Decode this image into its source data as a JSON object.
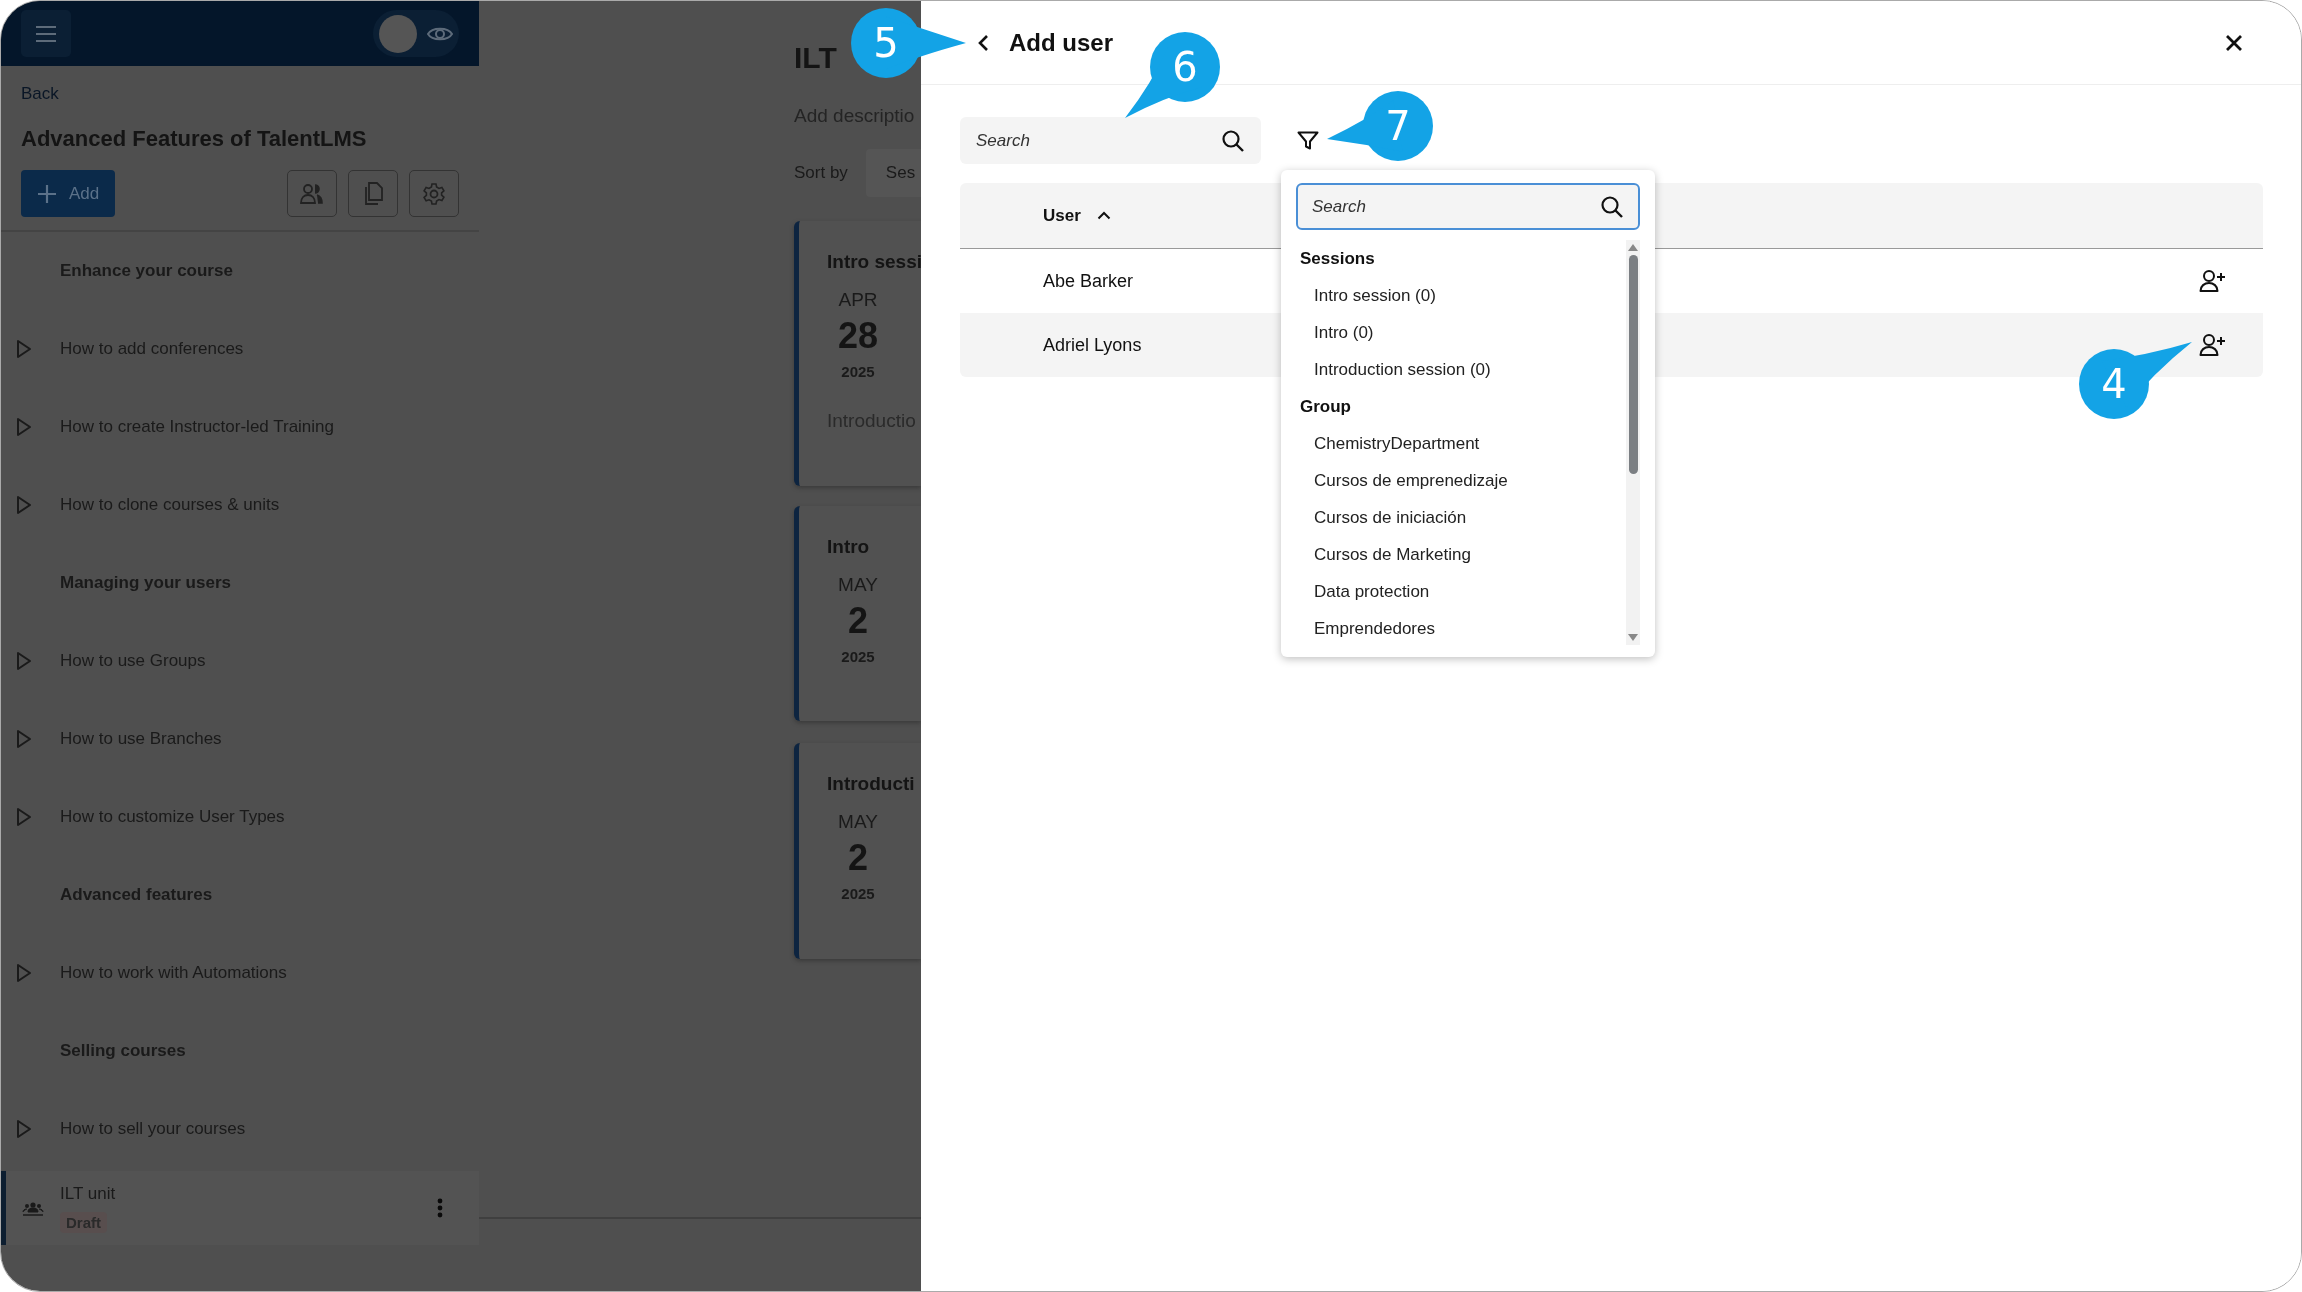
{
  "preview_toggle": {
    "on": false
  },
  "sidebar": {
    "back": "Back",
    "course_title": "Advanced Features of TalentLMS",
    "add_button": "Add",
    "items": [
      {
        "kind": "section",
        "label": "Enhance your course"
      },
      {
        "kind": "unit",
        "label": "How to add conferences"
      },
      {
        "kind": "unit",
        "label": "How to create Instructor-led Training"
      },
      {
        "kind": "unit",
        "label": "How to clone courses & units"
      },
      {
        "kind": "section",
        "label": "Managing your users"
      },
      {
        "kind": "unit",
        "label": "How to use Groups"
      },
      {
        "kind": "unit",
        "label": "How to use Branches"
      },
      {
        "kind": "unit",
        "label": "How to customize User Types"
      },
      {
        "kind": "section",
        "label": "Advanced features"
      },
      {
        "kind": "unit",
        "label": "How to work with Automations"
      },
      {
        "kind": "section",
        "label": "Selling courses"
      },
      {
        "kind": "unit",
        "label": "How to sell your courses"
      }
    ],
    "current_unit": {
      "label": "ILT unit",
      "status": "Draft",
      "selected": true
    }
  },
  "main": {
    "title": "ILT",
    "description_placeholder": "Add descriptio",
    "sort_label": "Sort by",
    "sort_value": "Ses",
    "sessions": [
      {
        "title": "Intro sessi",
        "month": "APR",
        "day": "28",
        "year": "2025",
        "subtitle": "Introductio"
      },
      {
        "title": "Intro",
        "month": "MAY",
        "day": "2",
        "year": "2025"
      },
      {
        "title": "Introducti",
        "month": "MAY",
        "day": "2",
        "year": "2025"
      }
    ]
  },
  "dialog": {
    "title": "Add user",
    "search_placeholder": "Search",
    "column": "User",
    "rows": [
      {
        "name": "Abe Barker"
      },
      {
        "name": "Adriel Lyons"
      }
    ]
  },
  "filter_dropdown": {
    "search_placeholder": "Search",
    "groups": [
      {
        "title": "Sessions",
        "options": [
          "Intro session (0)",
          "Intro (0)",
          "Introduction session (0)"
        ]
      },
      {
        "title": "Group",
        "options": [
          "ChemistryDepartment",
          "Cursos de emprenedizaje",
          "Cursos de iniciación",
          "Cursos de Marketing",
          "Data protection",
          "Emprendedores"
        ]
      }
    ]
  },
  "callouts": [
    {
      "label": "5"
    },
    {
      "label": "6"
    },
    {
      "label": "7"
    },
    {
      "label": "4"
    }
  ]
}
